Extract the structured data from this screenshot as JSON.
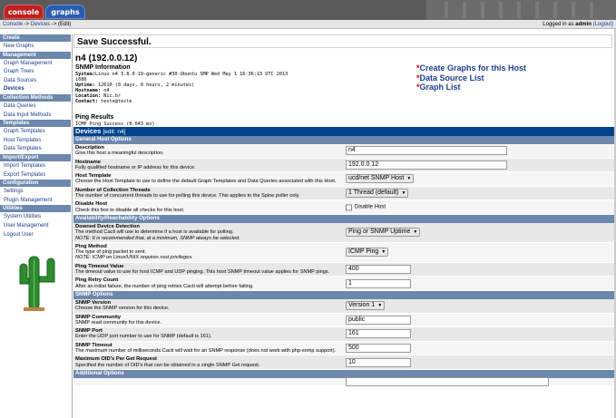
{
  "tabs": {
    "console": "console",
    "graphs": "graphs"
  },
  "breadcrumb": {
    "c1": "Console",
    "sep1": " -> ",
    "c2": "Devices",
    "sep2": " -> ",
    "c3": "(Edit)"
  },
  "login": {
    "prefix": "Logged in as ",
    "user": "admin",
    "logout": "(Logout)"
  },
  "sidebar": [
    {
      "type": "head",
      "label": "Create"
    },
    {
      "type": "item",
      "label": "New Graphs"
    },
    {
      "type": "head",
      "label": "Management"
    },
    {
      "type": "item",
      "label": "Graph Management"
    },
    {
      "type": "item",
      "label": "Graph Trees"
    },
    {
      "type": "item",
      "label": "Data Sources"
    },
    {
      "type": "item",
      "label": "Devices",
      "active": true
    },
    {
      "type": "head",
      "label": "Collection Methods"
    },
    {
      "type": "item",
      "label": "Data Queries"
    },
    {
      "type": "item",
      "label": "Data Input Methods"
    },
    {
      "type": "head",
      "label": "Templates"
    },
    {
      "type": "item",
      "label": "Graph Templates"
    },
    {
      "type": "item",
      "label": "Host Templates"
    },
    {
      "type": "item",
      "label": "Data Templates"
    },
    {
      "type": "head",
      "label": "Import/Export"
    },
    {
      "type": "item",
      "label": "Import Templates"
    },
    {
      "type": "item",
      "label": "Export Templates"
    },
    {
      "type": "head",
      "label": "Configuration"
    },
    {
      "type": "item",
      "label": "Settings"
    },
    {
      "type": "item",
      "label": "Plugin Management"
    },
    {
      "type": "head",
      "label": "Utilities"
    },
    {
      "type": "item",
      "label": "System Utilities"
    },
    {
      "type": "item",
      "label": "User Management"
    },
    {
      "type": "item",
      "label": "Logout User"
    }
  ],
  "save_message": "Save Successful.",
  "host_title": "n4 (192.0.0.12)",
  "snmp": {
    "title": "SNMP Information",
    "lines": [
      {
        "k": "System:",
        "v": "Linux n4 3.8.0-19-generic #30-Ubuntu SMP Wed May 1 16:36:13 UTC 2013"
      },
      {
        "k": "",
        "v": "i686"
      },
      {
        "k": "Uptime:",
        "v": " 12610 (0 days, 0 hours, 2 minutes)"
      },
      {
        "k": "Hostname:",
        "v": " n4"
      },
      {
        "k": "Location:",
        "v": " Nic.br"
      },
      {
        "k": "Contact:",
        "v": " teste@teste"
      }
    ]
  },
  "actions": [
    "Create Graphs for this Host",
    "Data Source List",
    "Graph List"
  ],
  "ping": {
    "title": "Ping Results",
    "line": "ICMP Ping Success (0.043 ms)"
  },
  "form": {
    "title": "Devices",
    "edit": "[edit: n4]",
    "sections": [
      {
        "title": "General Host Options",
        "rows": [
          {
            "label": "Description",
            "desc": "Give this host a meaningful description.",
            "kind": "text",
            "value": "n4",
            "w": 178
          },
          {
            "label": "Hostname",
            "desc": "Fully qualified hostname or IP address for this device.",
            "kind": "text",
            "value": "192.0.0.12",
            "w": 178
          },
          {
            "label": "Host Template",
            "desc": "Choose the Host Template to use to define the default Graph Templates and Data Queries associated with this Host.",
            "kind": "select",
            "value": "ucd/net SNMP Host"
          },
          {
            "label": "Number of Collection Threads",
            "desc": "The number of concurrent threads to use for polling this device. This applies to the Spine poller only.",
            "kind": "select",
            "value": "1 Thread (default)"
          },
          {
            "label": "Disable Host",
            "desc": "Check this box to disable all checks for this host.",
            "kind": "check",
            "value": "Disable Host"
          }
        ]
      },
      {
        "title": "Availability/Reachability Options",
        "rows": [
          {
            "label": "Downed Device Detection",
            "desc": "The method Cacti will use to determine if a host is available for polling.",
            "note": "NOTE: It is recommended that, at a minimum, SNMP always be selected.",
            "kind": "select",
            "value": "Ping or SNMP Uptime"
          },
          {
            "label": "Ping Method",
            "desc": "The type of ping packet to sent.",
            "note": "NOTE: ICMP on Linux/UNIX requires root privileges.",
            "kind": "select",
            "value": "ICMP Ping"
          },
          {
            "label": "Ping Timeout Value",
            "desc": "The timeout value to use for host ICMP and UDP pinging. This host SNMP timeout value applies for SNMP pings.",
            "kind": "text",
            "value": "400",
            "w": 72
          },
          {
            "label": "Ping Retry Count",
            "desc": "After an initial failure, the number of ping retries Cacti will attempt before failing.",
            "kind": "text",
            "value": "1",
            "w": 72
          }
        ]
      },
      {
        "title": "SNMP Options",
        "rows": [
          {
            "label": "SNMP Version",
            "desc": "Choose the SNMP version for this device.",
            "kind": "select",
            "value": "Version 1"
          },
          {
            "label": "SNMP Community",
            "desc": "SNMP read community for this device.",
            "kind": "text",
            "value": "public",
            "w": 72
          },
          {
            "label": "SNMP Port",
            "desc": "Enter the UDP port number to use for SNMP (default is 161).",
            "kind": "text",
            "value": "161",
            "w": 72
          },
          {
            "label": "SNMP Timeout",
            "desc": "The maximum number of milliseconds Cacti will wait for an SNMP response (does not work with php-snmp support).",
            "kind": "text",
            "value": "500",
            "w": 72
          },
          {
            "label": "Maximum OID's Per Get Request",
            "desc": "Specified the number of OID's that can be obtained in a single SNMP Get request.",
            "kind": "text",
            "value": "10",
            "w": 72
          }
        ]
      },
      {
        "title": "Additional Options",
        "rows": [
          {
            "label": "",
            "desc": "",
            "kind": "text",
            "value": "",
            "w": 224
          }
        ]
      }
    ]
  }
}
